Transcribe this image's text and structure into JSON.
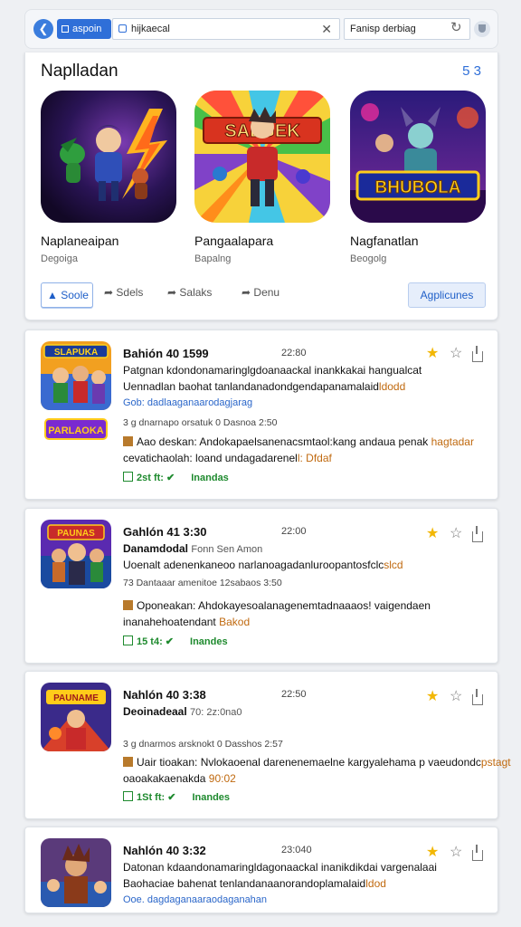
{
  "browser": {
    "tab_label": "aspoin",
    "address": "hijkaecal",
    "search": "Fanisp derbiag"
  },
  "featured": {
    "title": "Naplladan",
    "count": "5 3",
    "apps": [
      {
        "name": "Naplaneaipan",
        "sub": "Degoiga",
        "banner": ""
      },
      {
        "name": "Pangaalapara",
        "sub": "Bapalng",
        "banner": "SALGEK"
      },
      {
        "name": "Nagfanatlan",
        "sub": "Beogolg",
        "banner": "BHUBOLA"
      }
    ],
    "actions": {
      "primary": "Soole",
      "a2": "Sdels",
      "a3": "Salaks",
      "a4": "Denu",
      "right": "Agplicunes"
    }
  },
  "feed": [
    {
      "logo": "SLAPUKA",
      "mini_logo": "PARLAOKA",
      "title": "Bahión 40 1599",
      "time": "22:80",
      "line1": "Patgnan kdondonamaringlgdoanaackal inankkakai hangualcat",
      "line2_a": "Uennadlan baohat tanlandanadondgendapanamalaid",
      "line2_hl": "ldodd",
      "link": "Gob: dadlaaganaarodagjarag",
      "meta": "3 g  dnarnapo orsatuk 0 Dasnoa 2:50",
      "note_a": "Aao deskan: Andokapaelsanenacsmtaol:kang andaua penak",
      "note_hl": "hagtadar",
      "note2_a": "cevatichaolah: loand undagadarenel",
      "note2_hl": "l: Dfdaf",
      "green_a": "2st ft:",
      "green_b": "Inandas"
    },
    {
      "logo": "PAUNAS",
      "title": "Gahlón 41 3:30",
      "time": "22:00",
      "line1_a": "Danamdodal",
      "line1_b": "Fonn Sen Amon",
      "line2_a": "Uoenalt adenenkaneoo narlanoagadanluroopantosfclc",
      "line2_hl": "slcd",
      "meta": "73  Dantaaar amenitoe 12sabaos 3:50",
      "note_a": "Oponeakan: Ahdokayesoalanagenemtadnaaaos! vaigendaen",
      "note2_a": "inanahehoatendant",
      "note2_hl": "Bakod",
      "green_a": "15 t4:",
      "green_b": "Inandes"
    },
    {
      "logo": "PAUNAME",
      "title": "Nahlón 40 3:38",
      "time": "22:50",
      "line1_a": "Deoinadeaal",
      "line1_b": "70: 2z:0na0",
      "meta": "3 g  dnarmos arsknokt 0 Dasshos 2:57",
      "note_a": "Uair tioakan: Nvlokaoenal darenenemaelne kargyalehama p vaeudondc",
      "note_hl": "pstagt",
      "note2_a": "oaoakakaenakda",
      "note2_hl": "90:02",
      "green_a": "1St ft:",
      "green_b": "Inandes"
    },
    {
      "logo": "",
      "title": "Nahlón 40 3:32",
      "time": "23:040",
      "line1": "Datonan kdaandonamaringldagonaackal inanikdikdai vargenalaai",
      "line2_a": "Baohaciae bahenat tenlandanaanorandoplamalaid",
      "line2_hl": "ldod",
      "link": "Ooe. dagdaganaaraodaganahan"
    }
  ],
  "colors": {
    "accent": "#2f6fd8",
    "star": "#f2b705",
    "highlight": "#c06a10",
    "green": "#1e8a2e"
  },
  "icons": [
    "back-icon",
    "tab-icon",
    "lock-icon",
    "close-icon",
    "refresh-icon",
    "shield-icon",
    "thumbs-up-icon",
    "share-arrow-icon",
    "star-icon",
    "star-outline-icon",
    "share-icon",
    "checkbox-icon"
  ]
}
